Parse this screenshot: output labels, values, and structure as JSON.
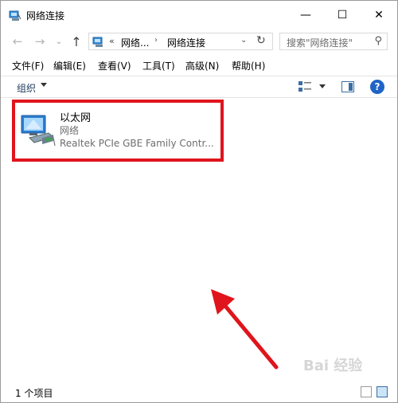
{
  "window": {
    "title": "网络连接",
    "controls": {
      "minimize": "—",
      "maximize": "☐",
      "close": "✕"
    }
  },
  "nav": {
    "back": "←",
    "forward": "→",
    "recent": "⌄",
    "up": "↑",
    "address": {
      "chevron": "«",
      "crumb1": "网络...",
      "separator": "›",
      "crumb2": "网络连接",
      "dropdown": "⌄",
      "refresh": "↻"
    },
    "search_placeholder": "搜索\"网络连接\"",
    "search_icon": "⚲"
  },
  "menu": [
    "文件(F)",
    "编辑(E)",
    "查看(V)",
    "工具(T)",
    "高级(N)",
    "帮助(H)"
  ],
  "command": {
    "organize": "组织",
    "help": "?"
  },
  "items": [
    {
      "name": "以太网",
      "type": "网络",
      "device": "Realtek PCIe GBE Family Contr..."
    }
  ],
  "status": {
    "count": "1 个项目"
  },
  "watermark": "Bai 经验",
  "colors": {
    "highlight": "#e0141c",
    "accent": "#1f63c6"
  }
}
